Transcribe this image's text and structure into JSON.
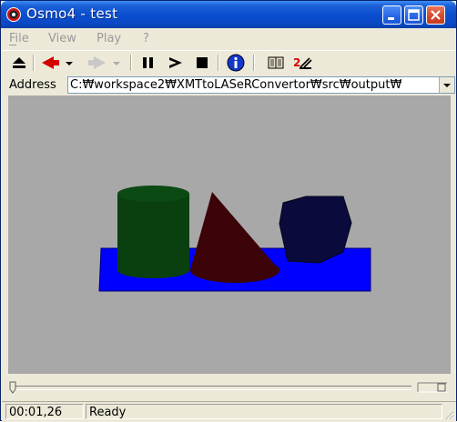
{
  "window": {
    "title": "Osmo4 - test",
    "icon": "osmo-app-icon",
    "controls": [
      "minimize-icon",
      "maximize-icon",
      "close-icon"
    ]
  },
  "menu": {
    "items": [
      "File",
      "View",
      "Play",
      "?"
    ]
  },
  "toolbar": {
    "buttons": [
      "eject-icon",
      "back-arrow-icon",
      "back-dropdown-icon",
      "forward-arrow-icon",
      "forward-dropdown-icon",
      "pause-icon",
      "play-icon",
      "stop-icon",
      "info-icon",
      "bookmark-icon",
      "speed-2x-icon"
    ],
    "speed_glyph": "2"
  },
  "address": {
    "label": "Address",
    "value": "C:₩workspace2₩XMTtoLASeRConvertor₩src₩output₩"
  },
  "scene": {
    "background_color": "#a8a8a8",
    "objects": [
      {
        "name": "base-box",
        "color": "#0000ff"
      },
      {
        "name": "cylinder",
        "color": "#0a4010"
      },
      {
        "name": "cone",
        "color": "#3c0408"
      },
      {
        "name": "cube",
        "color": "#0a0a3c"
      }
    ]
  },
  "status": {
    "time": "00:01,26",
    "message": "Ready"
  },
  "colors": {
    "title_bar": "#0a4fd0",
    "chrome": "#ece9d8"
  }
}
